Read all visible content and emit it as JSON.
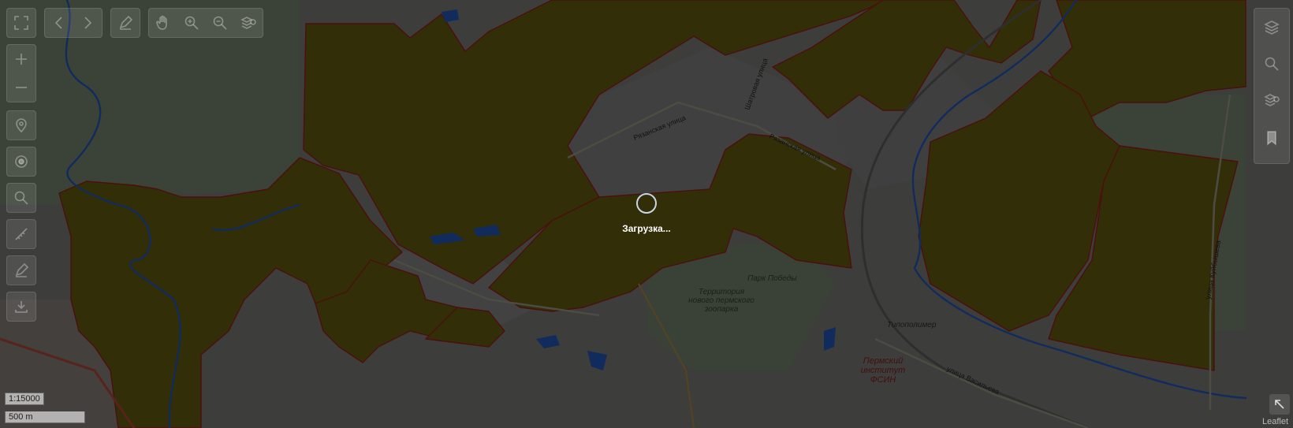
{
  "map": {
    "labels": {
      "ryazanskaya1": "Рязанская улица",
      "ryazanskaya2": "Рязанская улица",
      "shatrovaya": "Шатровая улица",
      "park": "Парк Победы",
      "territory": "Территория нового пермского зоопарка",
      "tiposolimer": "Типополимер",
      "institute": "Пермский институт ФСИН",
      "vasilieva": "улица Васильева",
      "kuybysheva": "улица Куйбышева"
    }
  },
  "status": {
    "loading_text": "Загрузка..."
  },
  "scale": {
    "ratio": "1:15000",
    "distance": "500 m"
  },
  "attribution": "Leaflet",
  "colors": {
    "forest_fill": "#5c5410",
    "forest_stroke": "#8b1a1a",
    "river": "#1f4fa8",
    "overlay": "rgba(0,0,0,0.45)"
  },
  "toolbar_top": {
    "items": [
      "fullscreen-icon",
      "back-icon",
      "forward-icon",
      "edit-icon",
      "pan-hand-icon",
      "zoom-in-icon",
      "zoom-out-icon",
      "layers-info-icon"
    ]
  },
  "toolbar_left": {
    "items": [
      "zoom-plus-icon",
      "zoom-minus-icon",
      "location-pin-icon",
      "target-icon",
      "search-icon",
      "ruler-icon",
      "draw-icon",
      "download-icon"
    ]
  },
  "toolbar_right": {
    "items": [
      "layers-icon",
      "search-icon",
      "layers-info-icon",
      "bookmark-icon"
    ]
  }
}
